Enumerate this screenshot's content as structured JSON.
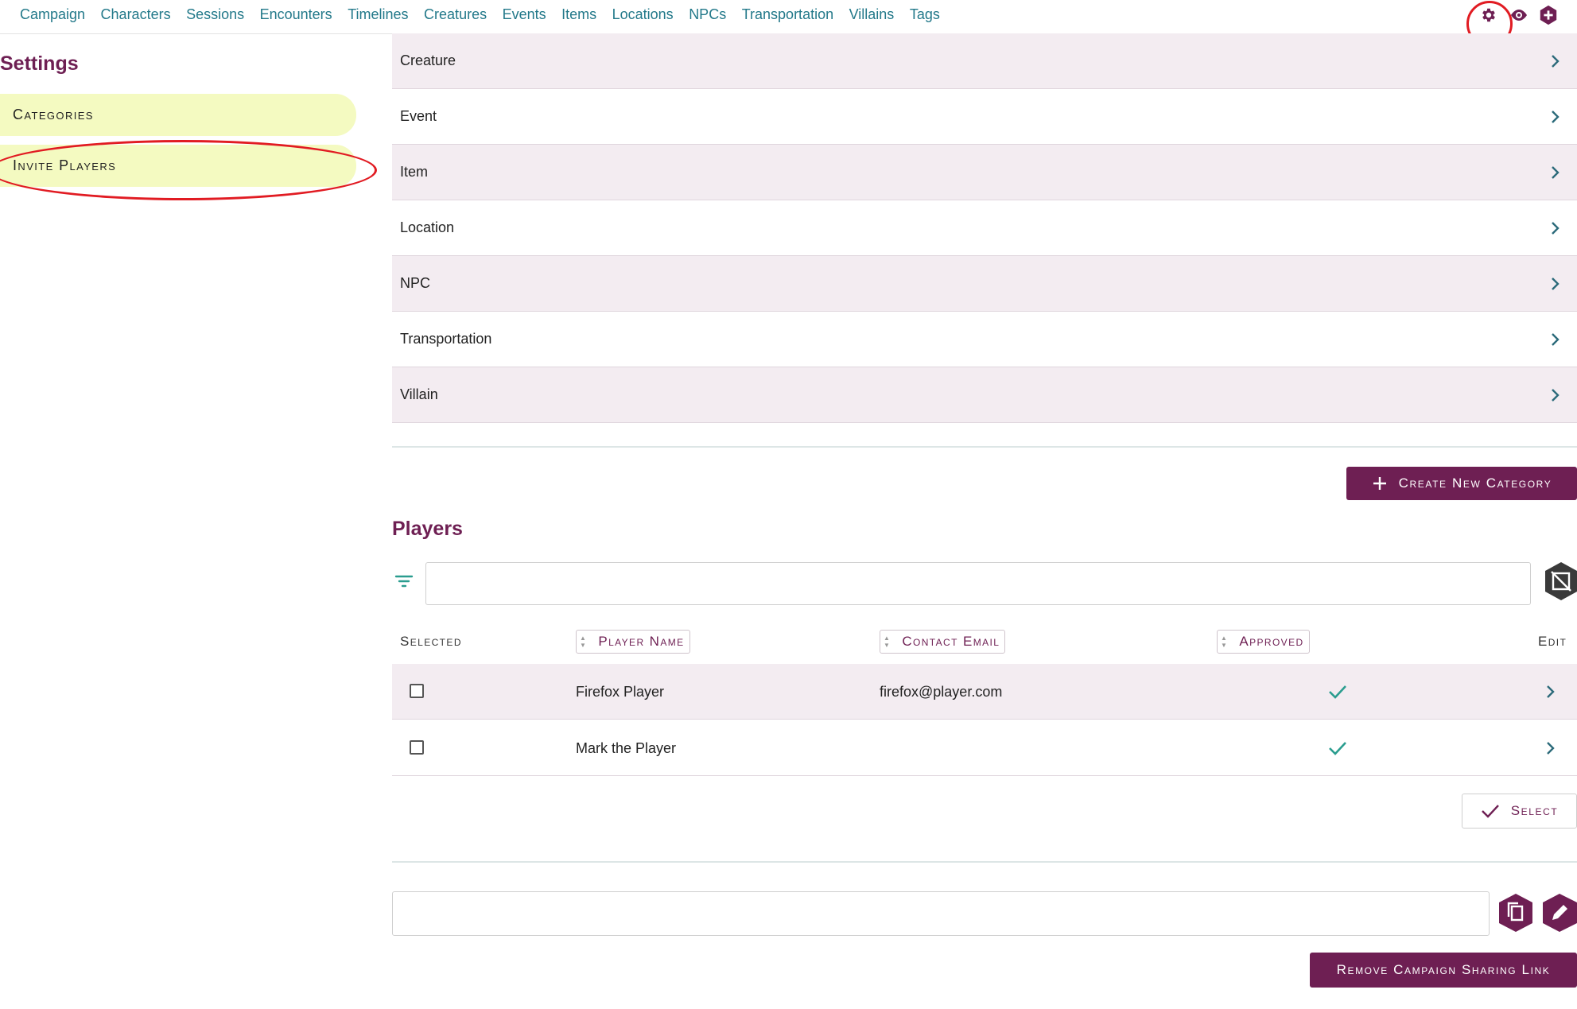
{
  "nav": {
    "links": [
      "Campaign",
      "Characters",
      "Sessions",
      "Encounters",
      "Timelines",
      "Creatures",
      "Events",
      "Items",
      "Locations",
      "NPCs",
      "Transportation",
      "Villains",
      "Tags"
    ],
    "icons": [
      "gear-icon",
      "eye-icon",
      "plus-icon"
    ]
  },
  "sidebar": {
    "title": "Settings",
    "items": [
      {
        "label": "Categories"
      },
      {
        "label": "Invite Players"
      }
    ]
  },
  "categories": {
    "items": [
      "Creature",
      "Event",
      "Item",
      "Location",
      "NPC",
      "Transportation",
      "Villain"
    ],
    "create_label": "Create New Category"
  },
  "players": {
    "title": "Players",
    "filter": {
      "value": "",
      "placeholder": ""
    },
    "columns": {
      "selected": "Selected",
      "player_name": "Player Name",
      "contact_email": "Contact Email",
      "approved": "Approved",
      "edit": "Edit"
    },
    "rows": [
      {
        "name": "Firefox Player",
        "email": "firefox@player.com",
        "approved": true,
        "selected": false
      },
      {
        "name": "Mark the Player",
        "email": "",
        "approved": true,
        "selected": false
      }
    ],
    "select_label": "Select"
  },
  "sharing": {
    "link_value": "",
    "remove_label": "Remove Campaign Sharing Link"
  },
  "colors": {
    "brand": "#6e1f53",
    "nav_link": "#23798a",
    "sidebar_highlight": "#f4fac1",
    "row_shade": "#f3ecf1",
    "check": "#2a9d8f",
    "annotation": "#e11b22"
  }
}
